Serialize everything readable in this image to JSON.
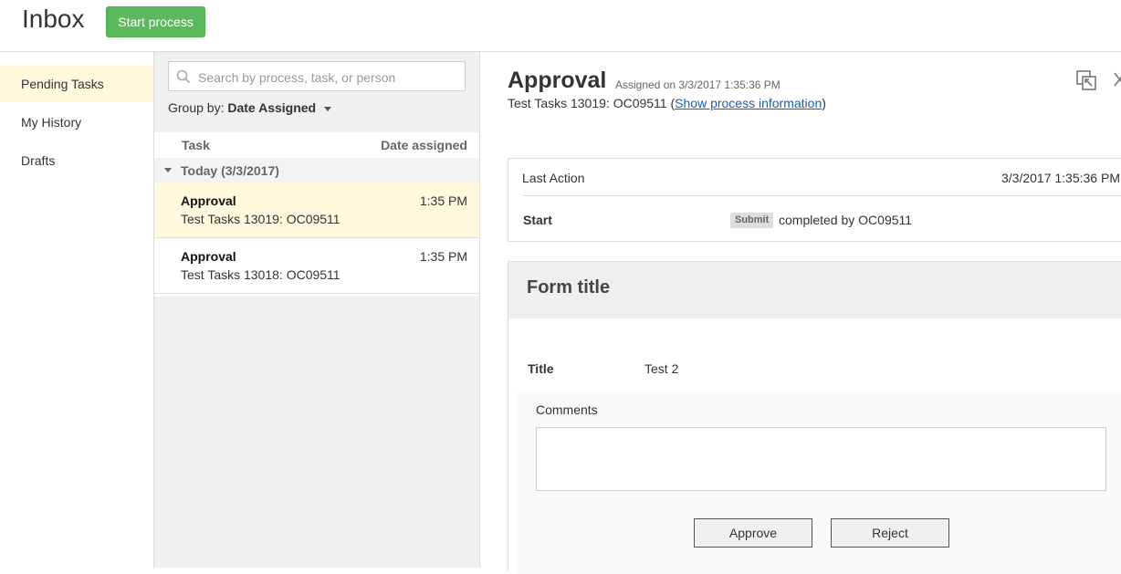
{
  "header": {
    "title": "Inbox",
    "start_process_label": "Start process",
    "start_process_color": "#5cb85c"
  },
  "nav": {
    "items": [
      {
        "label": "Pending Tasks",
        "active": true
      },
      {
        "label": "My History",
        "active": false
      },
      {
        "label": "Drafts",
        "active": false
      }
    ]
  },
  "task_list": {
    "search_placeholder": "Search by process, task, or person",
    "group_by_label": "Group by:",
    "group_by_value": "Date Assigned",
    "columns": {
      "task": "Task",
      "date": "Date assigned"
    },
    "group": "Today (3/3/2017)",
    "tasks": [
      {
        "name": "Approval",
        "desc": "Test Tasks 13019: OC09511",
        "time": "1:35 PM",
        "selected": true
      },
      {
        "name": "Approval",
        "desc": "Test Tasks 13018: OC09511",
        "time": "1:35 PM",
        "selected": false
      }
    ]
  },
  "detail": {
    "title": "Approval",
    "assigned_on": "Assigned on 3/3/2017 1:35:36 PM",
    "subline_text": "Test Tasks 13019: OC09511",
    "open_paren": "(",
    "show_process_link": "Show process information",
    "close_paren": ")",
    "icons": [
      "popout-icon",
      "close-icon"
    ],
    "last_action": {
      "label": "Last Action",
      "date": "3/3/2017 1:35:36 PM",
      "step": "Start",
      "badge": "Submit",
      "completed_by": "completed by OC09511"
    },
    "form": {
      "title": "Form title",
      "fields": [
        {
          "label": "Title",
          "value": "Test 2"
        }
      ],
      "comments_label": "Comments",
      "comments_value": "",
      "approve_label": "Approve",
      "reject_label": "Reject"
    }
  }
}
